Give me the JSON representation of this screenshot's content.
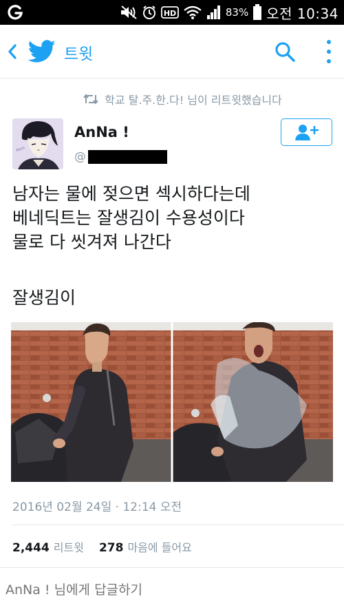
{
  "status_bar": {
    "carrier_icon": "olleh-g-icon",
    "battery_percent": "83%",
    "time": "오전 10:34",
    "icons": [
      "mute-icon",
      "alarm-icon",
      "hd-icon",
      "wifi-icon",
      "signal-icon",
      "battery-icon"
    ]
  },
  "app_bar": {
    "title": "트윗",
    "accent_color": "#1da1f2"
  },
  "retweet_notice": "학교 탈.주.한.다! 님이 리트윗했습니다",
  "tweet": {
    "author_name": "AnNa !",
    "handle_prefix": "@",
    "text_lines": [
      "남자는 물에 젖으면 섹시하다는데",
      "베네딕트는 잘생김이 수용성이다",
      "물로 다 씻겨져 나간다"
    ],
    "extra_line": "잘생김이",
    "timestamp": "2016년 02월 24일 · 12:14 오전",
    "retweet_count": "2,444",
    "retweet_label": "리트윗",
    "like_count": "278",
    "like_label": "마음에 들어요"
  },
  "reply": {
    "placeholder": "AnNa ! 님에게 답글하기"
  }
}
